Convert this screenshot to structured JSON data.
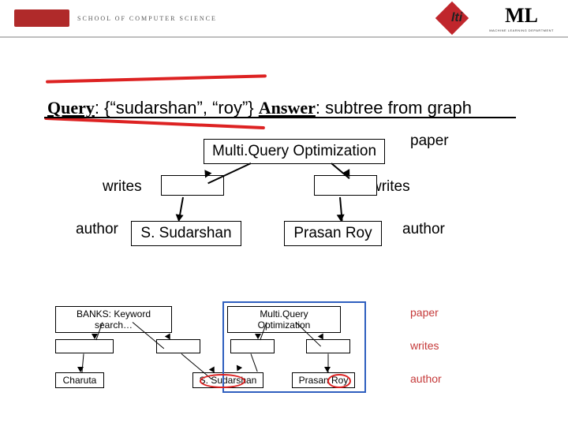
{
  "header": {
    "school_text": "SCHOOL OF COMPUTER SCIENCE",
    "lti_text": "lti",
    "ml_text": "ML",
    "ml_sub": "MACHINE LEARNING DEPARTMENT"
  },
  "title": {
    "query_label": "Query",
    "query_value": ":  {“sudarshan”, “roy”}  ",
    "answer_label": "Answer",
    "answer_value": ": subtree from graph"
  },
  "graph": {
    "top_node": "Multi.Query Optimization",
    "top_right_label": "paper",
    "writes_left": "writes",
    "writes_right": "writes",
    "author_left": "author",
    "author_right": "author",
    "node_left": "S. Sudarshan",
    "node_right": "Prasan Roy"
  },
  "small": {
    "paper": "paper",
    "writes": "writes",
    "author": "author",
    "n_banks": "BANKS: Keyword search…",
    "n_mqo": "Multi.Query Optimization",
    "n_charuta": "Charuta",
    "n_sud": "S. Sudarshan",
    "n_roy": "Prasan Roy"
  }
}
